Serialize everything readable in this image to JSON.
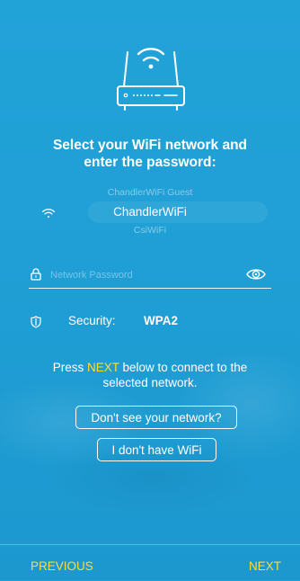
{
  "heading": {
    "line1": "Select your WiFi network and",
    "line2": "enter the password:"
  },
  "network_picker": {
    "previous_option": "ChandlerWiFi Guest",
    "selected": "ChandlerWiFi",
    "next_option": "CsiWiFi"
  },
  "password": {
    "placeholder": "Network Password",
    "value": ""
  },
  "security": {
    "label": "Security:",
    "value": "WPA2"
  },
  "instructions": {
    "before": "Press ",
    "highlight": "NEXT",
    "after_line1": " below to connect to the",
    "line2": "selected network."
  },
  "buttons": {
    "no_network": "Don't see your network?",
    "no_wifi": "I don't have WiFi"
  },
  "footer": {
    "previous": "PREVIOUS",
    "next": "NEXT"
  },
  "colors": {
    "background": "#22a3d8",
    "accent": "#ffdd33",
    "text": "#ffffff"
  },
  "icons": [
    "router-icon",
    "wifi-icon",
    "lock-icon",
    "eye-icon",
    "shield-icon"
  ]
}
